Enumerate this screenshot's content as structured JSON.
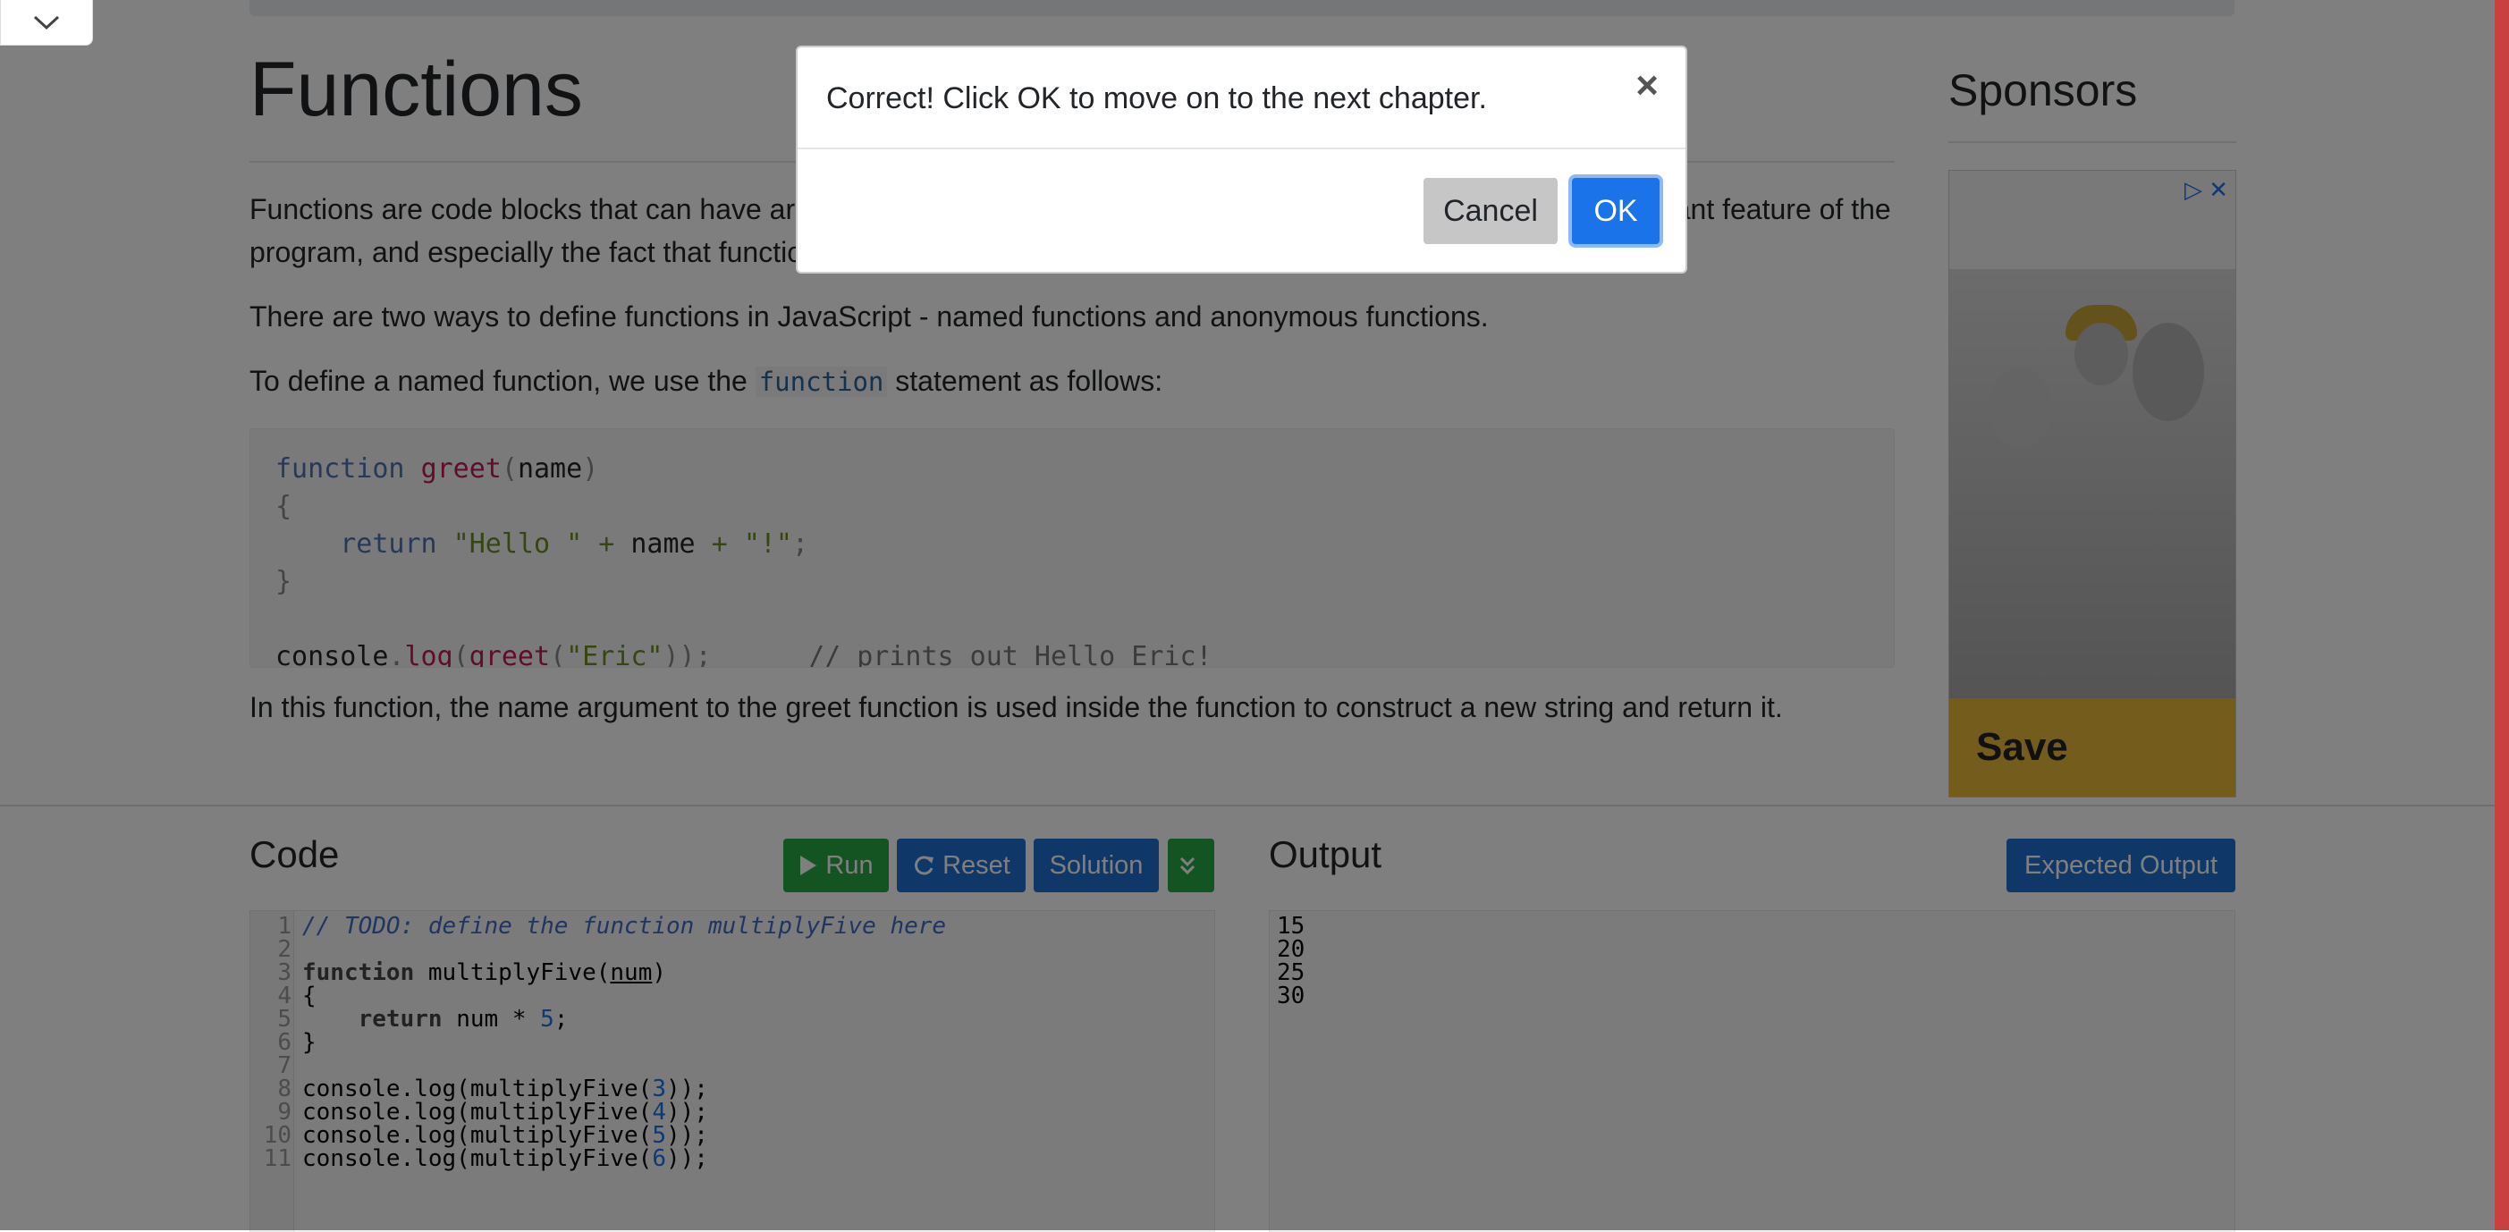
{
  "article": {
    "title": "Functions",
    "para1": "Functions are code blocks that can have arguments, and function has its own scope. Functions are a very important feature of the program, and especially the fact that function can access global variables of the function (this is called a closure).",
    "para2": "There are two ways to define functions in JavaScript - named functions and anonymous functions.",
    "para3_before": "To define a named function, we use the",
    "para3_code": "function",
    "para3_after": "statement as follows:",
    "para4": "In this function, the name argument to the greet function is used inside the function to construct a new string and return it."
  },
  "sidebar": {
    "title": "Sponsors",
    "ad_text": "Save",
    "ad_controls": "▷ ✕"
  },
  "editor": {
    "code_title": "Code",
    "output_title": "Output",
    "run_label": "Run",
    "reset_label": "Reset",
    "solution_label": "Solution",
    "expected_label": "Expected Output",
    "line_numbers": "1\n2\n3\n4\n5\n6\n7\n8\n9\n10\n11",
    "output_lines": "15\n20\n25\n30"
  },
  "modal": {
    "message": "Correct! Click OK to move on to the next chapter.",
    "close": "×",
    "cancel_label": "Cancel",
    "ok_label": "OK"
  },
  "colors": {
    "accent": "#1f6fd1",
    "run": "#28a745",
    "ok": "#1a73e8"
  }
}
